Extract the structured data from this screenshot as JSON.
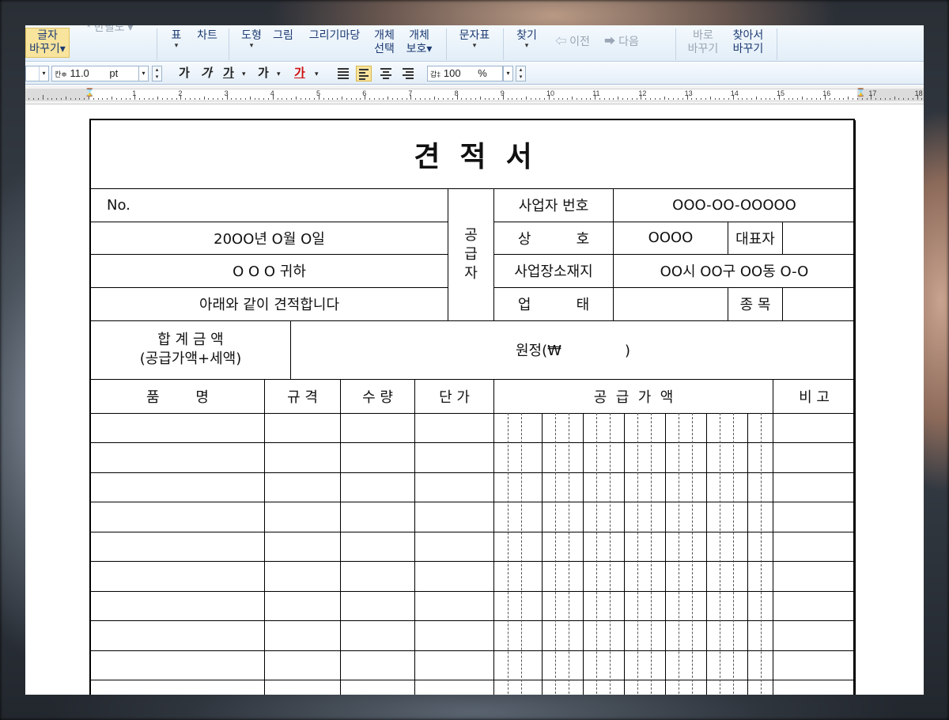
{
  "toolbar": {
    "items": [
      {
        "id": "char-replace",
        "line1": "글자",
        "line2": "바꾸기▾"
      },
      {
        "id": "layout-faded",
        "line1": "* 반필노 ▾",
        "line2": ""
      },
      {
        "id": "table",
        "line1": "표",
        "line2": "▾"
      },
      {
        "id": "chart",
        "line1": "차트",
        "line2": ""
      },
      {
        "id": "shape",
        "line1": "도형",
        "line2": "▾"
      },
      {
        "id": "picture",
        "line1": "그림",
        "line2": ""
      },
      {
        "id": "drawing-market",
        "line1": "그리기마당",
        "line2": ""
      },
      {
        "id": "select-object",
        "line1": "개체",
        "line2": "선택"
      },
      {
        "id": "protect-object",
        "line1": "개체",
        "line2": "보호▾"
      },
      {
        "id": "char-map",
        "line1": "문자표",
        "line2": "▾"
      },
      {
        "id": "find",
        "line1": "찾기",
        "line2": "▾"
      },
      {
        "id": "prev",
        "line1": "이전",
        "line2": ""
      },
      {
        "id": "next",
        "line1": "다음",
        "line2": ""
      },
      {
        "id": "quick-replace",
        "line1": "바로",
        "line2": "바꾸기"
      },
      {
        "id": "find-replace",
        "line1": "찾아서",
        "line2": "바꾸기"
      }
    ],
    "arrows": {
      "prev": "⇦",
      "next": "➡"
    }
  },
  "format_bar": {
    "font_size_prefix": "칸≑",
    "font_size": "11.0",
    "font_unit": "pt",
    "bold": "가",
    "italic": "가",
    "underline": "가",
    "strike": "가",
    "color": "가",
    "char_spacing_prefix": "갑‡",
    "char_spacing": "100",
    "char_spacing_unit": "%",
    "text_color_hex": "#d01010"
  },
  "ruler": {
    "numbers": [
      "1",
      "2",
      "3",
      "4",
      "5",
      "6",
      "7",
      "8",
      "9",
      "10",
      "11",
      "12",
      "13",
      "14",
      "15",
      "16",
      "17",
      "18"
    ]
  },
  "document": {
    "title": "견  적  서",
    "no_label": "No.",
    "date": "20OO년 O월 O일",
    "recipient": "O O O 귀하",
    "intro": "아래와 같이 견적합니다",
    "supplier_vertical": [
      "공",
      "급",
      "자"
    ],
    "biz_number_label": "사업자 번호",
    "biz_number": "OOO-OO-OOOOO",
    "company_label": "상          호",
    "company": "OOOO",
    "ceo_label": "대표자",
    "ceo": "",
    "address_label": "사업장소재지",
    "address": "OO시 OO구 OO동 O-O",
    "business_type_label": "업          태",
    "business_type": "",
    "item_type_label": "종 목",
    "item_type": "",
    "total_label_line1": "합 계 금 액",
    "total_label_line2": "(공급가액+세액)",
    "total_value": "원정(₩              )",
    "columns": [
      "품        명",
      "규 격",
      "수 량",
      "단 가",
      "공  급  가  액",
      "비 고"
    ]
  }
}
